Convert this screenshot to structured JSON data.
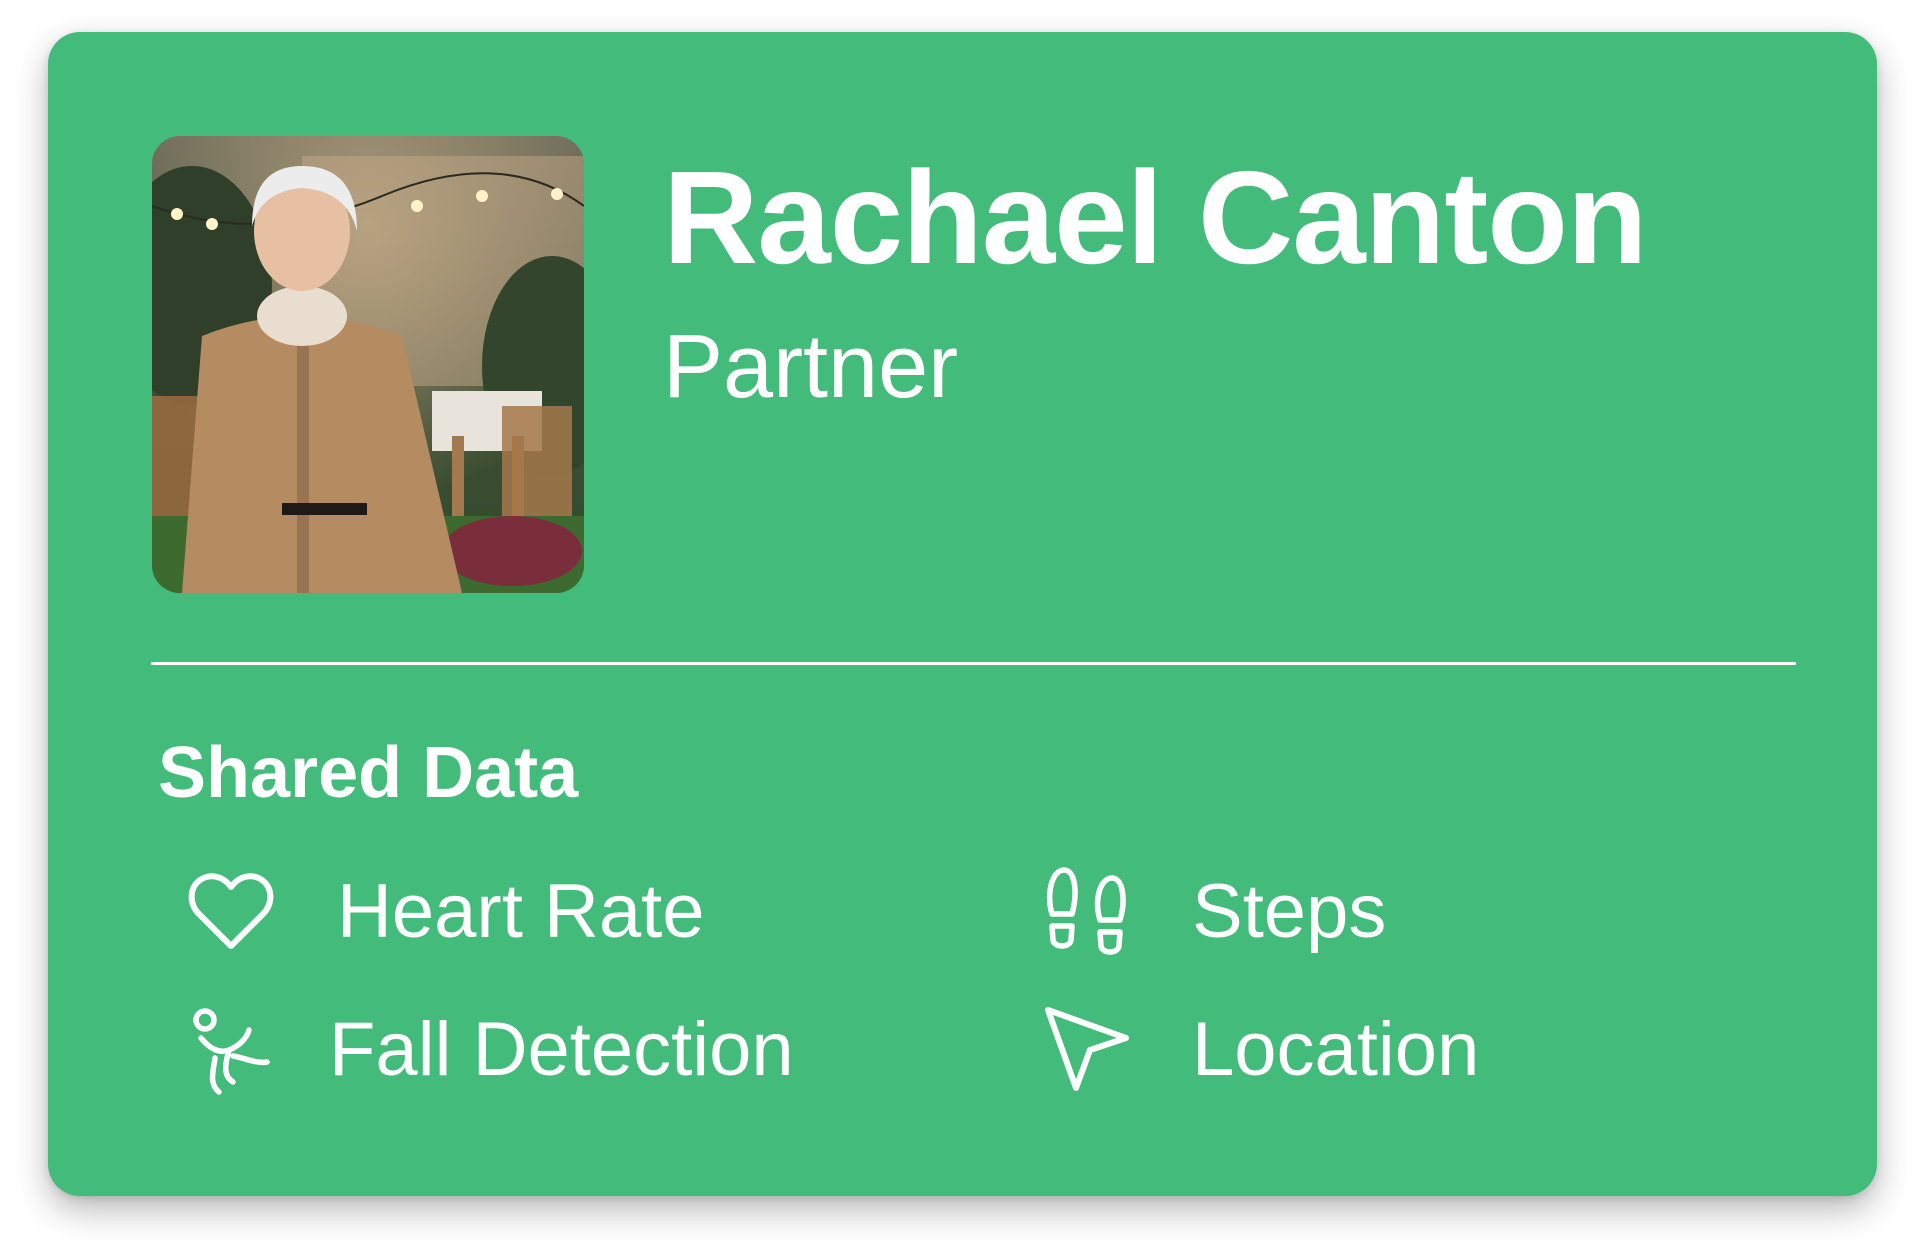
{
  "contact": {
    "name": "Rachael Canton",
    "relation": "Partner",
    "avatar_alt": "Photo of Rachael Canton"
  },
  "shared": {
    "title": "Shared Data",
    "items": [
      {
        "label": "Heart Rate",
        "icon": "heart-icon"
      },
      {
        "label": "Steps",
        "icon": "footprints-icon"
      },
      {
        "label": "Fall Detection",
        "icon": "fall-detection-icon"
      },
      {
        "label": "Location",
        "icon": "location-arrow-icon"
      }
    ]
  },
  "colors": {
    "card_background": "#43bc7b",
    "text": "#ffffff"
  }
}
